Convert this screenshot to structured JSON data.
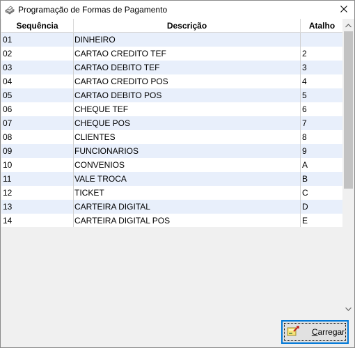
{
  "window": {
    "title": "Programação de Formas de Pagamento"
  },
  "table": {
    "columns": [
      "Sequência",
      "Descrição",
      "Atalho"
    ],
    "rows": [
      {
        "seq": "01",
        "desc": "DINHEIRO",
        "key": ""
      },
      {
        "seq": "02",
        "desc": "CARTAO CREDITO TEF",
        "key": "2"
      },
      {
        "seq": "03",
        "desc": "CARTAO DEBITO TEF",
        "key": "3"
      },
      {
        "seq": "04",
        "desc": "CARTAO CREDITO POS",
        "key": "4"
      },
      {
        "seq": "05",
        "desc": "CARTAO DEBITO POS",
        "key": "5"
      },
      {
        "seq": "06",
        "desc": "CHEQUE TEF",
        "key": "6"
      },
      {
        "seq": "07",
        "desc": "CHEQUE POS",
        "key": "7"
      },
      {
        "seq": "08",
        "desc": "CLIENTES",
        "key": "8"
      },
      {
        "seq": "09",
        "desc": "FUNCIONARIOS",
        "key": "9"
      },
      {
        "seq": "10",
        "desc": "CONVENIOS",
        "key": "A"
      },
      {
        "seq": "11",
        "desc": "VALE TROCA",
        "key": "B"
      },
      {
        "seq": "12",
        "desc": "TICKET",
        "key": "C"
      },
      {
        "seq": "13",
        "desc": "CARTEIRA DIGITAL",
        "key": "D"
      },
      {
        "seq": "14",
        "desc": "CARTEIRA DIGITAL POS",
        "key": "E"
      }
    ]
  },
  "buttons": {
    "load_first": "C",
    "load_rest": "arregar"
  },
  "icons": {
    "app": "printer-icon",
    "close": "close-icon",
    "load": "load-icon"
  },
  "colors": {
    "row_alt": "#e8effb",
    "focus_border": "#0078d7"
  }
}
